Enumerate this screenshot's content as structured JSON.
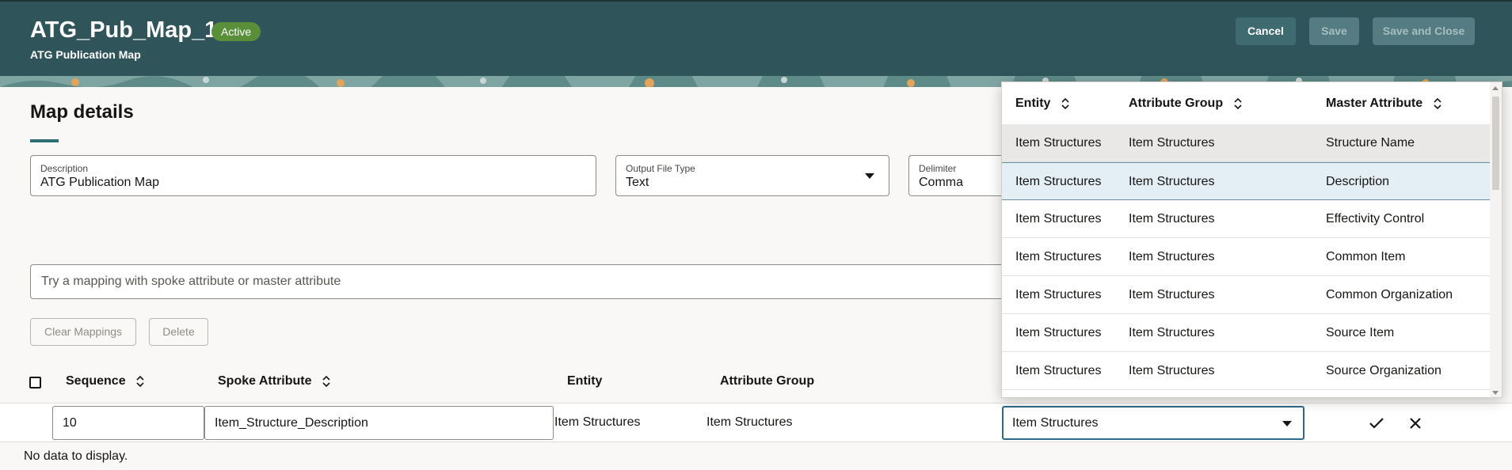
{
  "header": {
    "title": "ATG_Pub_Map_1",
    "status": "Active",
    "subtitle": "ATG Publication Map",
    "cancel_label": "Cancel",
    "save_label": "Save",
    "save_close_label": "Save and Close"
  },
  "details": {
    "title": "Map details",
    "description": {
      "label": "Description",
      "value": "ATG Publication Map"
    },
    "output_file_type": {
      "label": "Output File Type",
      "value": "Text"
    },
    "delimiter": {
      "label": "Delimiter",
      "value": "Comma"
    }
  },
  "search": {
    "placeholder": "Try a mapping with spoke attribute or master attribute"
  },
  "actions": {
    "clear_label": "Clear Mappings",
    "delete_label": "Delete"
  },
  "table": {
    "columns": {
      "sequence": "Sequence",
      "spoke": "Spoke Attribute",
      "entity": "Entity",
      "group": "Attribute Group"
    },
    "edit_row": {
      "sequence": "10",
      "spoke_attribute": "Item_Structure_Description",
      "entity": "Item Structures",
      "attribute_group": "Item Structures",
      "entity_select": "Item Structures"
    },
    "empty_text": "No data to display."
  },
  "popup": {
    "columns": {
      "entity": "Entity",
      "group": "Attribute Group",
      "master": "Master Attribute"
    },
    "rows": [
      {
        "entity": "Item Structures",
        "group": "Item Structures",
        "master": "Structure Name"
      },
      {
        "entity": "Item Structures",
        "group": "Item Structures",
        "master": "Description"
      },
      {
        "entity": "Item Structures",
        "group": "Item Structures",
        "master": "Effectivity Control"
      },
      {
        "entity": "Item Structures",
        "group": "Item Structures",
        "master": "Common Item"
      },
      {
        "entity": "Item Structures",
        "group": "Item Structures",
        "master": "Common Organization"
      },
      {
        "entity": "Item Structures",
        "group": "Item Structures",
        "master": "Source Item"
      },
      {
        "entity": "Item Structures",
        "group": "Item Structures",
        "master": "Source Organization"
      }
    ],
    "hovered_row": 0,
    "selected_row": 1
  },
  "colors": {
    "header_bg": "#2f5459",
    "badge_bg": "#5a8f3a",
    "accent": "#2f6f74",
    "selected_row": "#e3eff5"
  }
}
